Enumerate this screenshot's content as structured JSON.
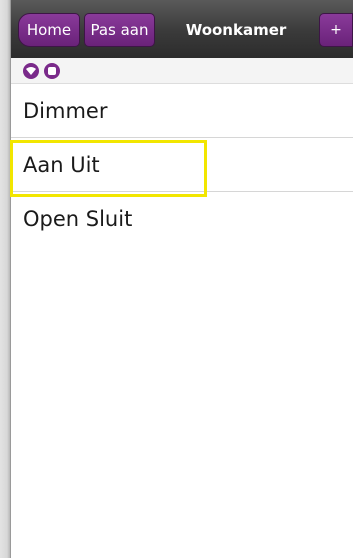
{
  "nav": {
    "home_label": "Home",
    "edit_label": "Pas aan",
    "title": "Woonkamer",
    "add_label": "+"
  },
  "status": {
    "icons": [
      "wifi-icon",
      "stop-icon"
    ],
    "accent_color": "#7a2a8a"
  },
  "list": {
    "items": [
      {
        "label": "Dimmer"
      },
      {
        "label": "Aan Uit",
        "highlighted": true
      },
      {
        "label": "Open Sluit"
      }
    ]
  },
  "colors": {
    "button_purple": "#6a2279",
    "highlight_yellow": "#f2e600"
  }
}
